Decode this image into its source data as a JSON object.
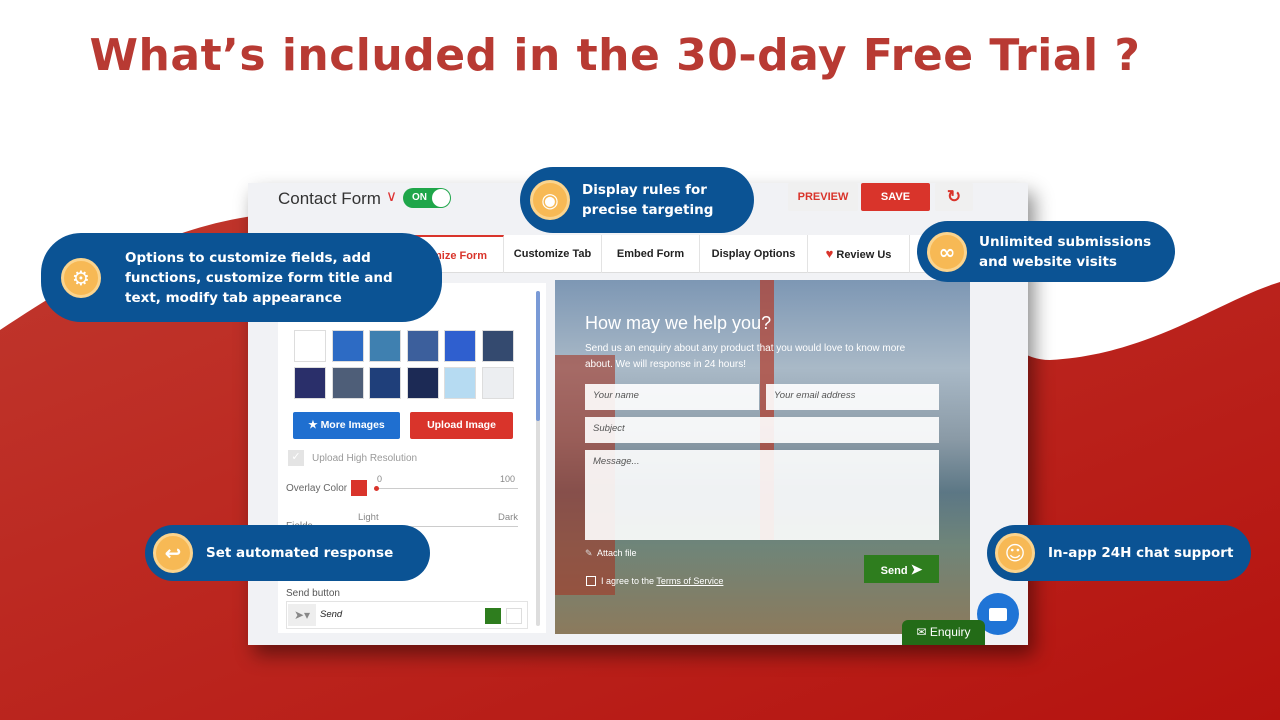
{
  "headline": "What’s included in the 30-day Free Trial ?",
  "colors": {
    "accent": "#b83a33",
    "bubble": "#0b5394",
    "icon_circle": "#f7b955",
    "save": "#d9342b",
    "toggle_on": "#1fa64a",
    "send": "#2e7d1e"
  },
  "app": {
    "form_name": "Contact Form",
    "toggle": "ON",
    "preview": "PREVIEW",
    "save": "SAVE",
    "tabs": [
      "Customize Form",
      "Customize Tab",
      "Embed Form",
      "Display Options",
      "Review Us"
    ],
    "panel": {
      "more_images": "More Images",
      "upload_image": "Upload Image",
      "high_res": "Upload High Resolution",
      "overlay_label": "Overlay Color",
      "overlay_value": 0,
      "slider_min": "0",
      "slider_max": "100",
      "light": "Light",
      "dark": "Dark",
      "fields_label": "Fields",
      "send_button_label": "Send button",
      "send_text": "Send"
    },
    "form": {
      "heading": "How may we help you?",
      "subtext": "Send us an enquiry about any product that you would love to know more about. We will response in 24 hours!",
      "name_ph": "Your name",
      "email_ph": "Your email address",
      "subject_ph": "Subject",
      "message_ph": "Message...",
      "attach": "Attach file",
      "agree": "I agree to the ",
      "terms": "Terms of Service",
      "send": "Send"
    },
    "enquiry": "Enquiry"
  },
  "bubbles": {
    "customize": "Options to customize fields, add functions, customize form title and text, modify tab appearance",
    "display": "Display rules for precise targeting",
    "unlimited": "Unlimited submissions and website visits",
    "auto": "Set automated response",
    "chat": "In-app 24H chat support"
  }
}
